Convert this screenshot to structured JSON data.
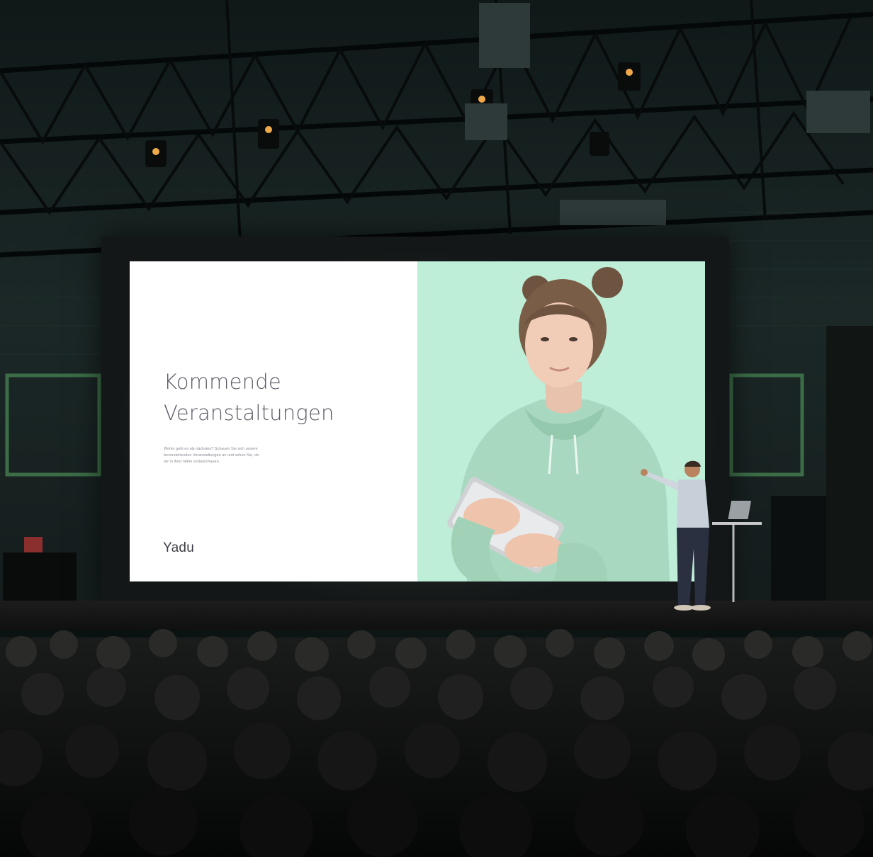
{
  "slide": {
    "title": "Kommende\nVeranstaltungen",
    "body": "Wohin geht es als nächstes? Schauen Sie sich unsere bevorstehenden Veranstaltungen an und sehen Sie, ob wir in Ihrer Nähe vorbeischauen.",
    "logo": "Yadu"
  },
  "colors": {
    "slide_left_bg": "#ffffff",
    "slide_right_bg": "#bfeed8",
    "title_text": "#5a5b66",
    "hoodie": "#a9d8c0",
    "venue_dark": "#0b1212"
  },
  "icons": {
    "stage_lights": "spotlight-icon",
    "laptop": "laptop-icon"
  }
}
